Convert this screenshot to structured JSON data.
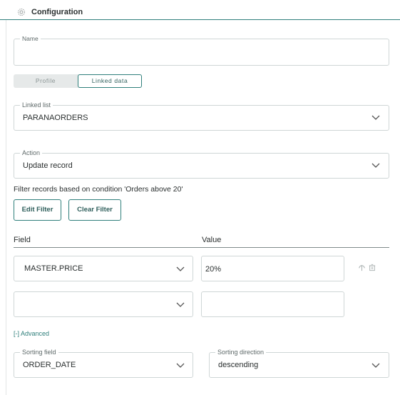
{
  "header": {
    "title": "Configuration",
    "icon": "gear-icon"
  },
  "form": {
    "name": {
      "label": "Name",
      "value": ""
    },
    "tabs": [
      {
        "label": "Profile",
        "active": false
      },
      {
        "label": "Linked data",
        "active": true
      }
    ],
    "linked_list": {
      "label": "Linked list",
      "value": "PARANAORDERS"
    },
    "action": {
      "label": "Action",
      "value": "Update record"
    },
    "filter_text": "Filter records based on condition 'Orders above 20'",
    "buttons": {
      "edit_filter": "Edit Filter",
      "clear_filter": "Clear Filter"
    },
    "columns": {
      "field": "Field",
      "value": "Value"
    },
    "rows": [
      {
        "field": "MASTER.PRICE",
        "value": "20%"
      },
      {
        "field": "",
        "value": ""
      }
    ],
    "advanced_label": "[-] Advanced",
    "sorting_field": {
      "label": "Sorting field",
      "value": "ORDER_DATE"
    },
    "sorting_direction": {
      "label": "Sorting direction",
      "value": "descending"
    }
  },
  "colors": {
    "accent": "#2f7f7b",
    "border": "#cfd6d6",
    "text": "#2a2f2f"
  }
}
